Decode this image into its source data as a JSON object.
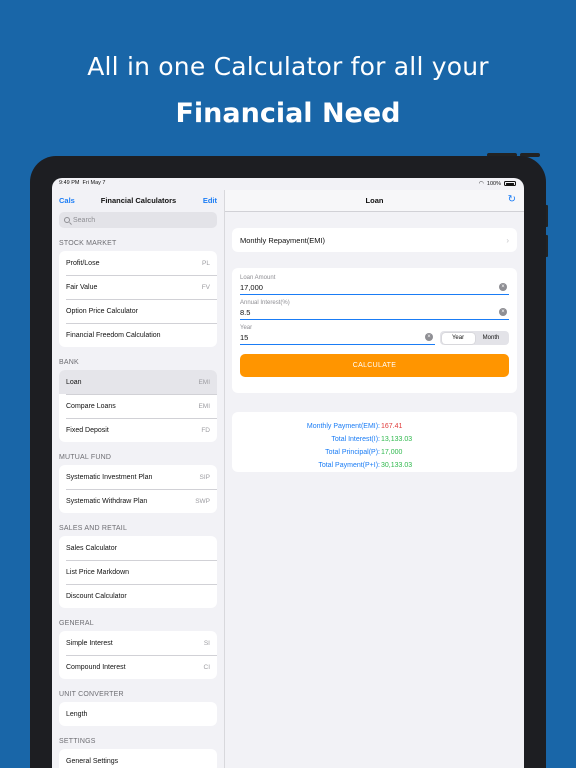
{
  "headline": {
    "line1": "All in one Calculator for all your",
    "line2": "Financial Need"
  },
  "status_bar": {
    "time": "9:49 PM",
    "date": "Fri May 7",
    "battery": "100%"
  },
  "sidebar": {
    "back_label": "Cals",
    "title": "Financial Calculators",
    "edit_label": "Edit",
    "search_placeholder": "Search",
    "sections": [
      {
        "header": "STOCK MARKET",
        "items": [
          {
            "label": "Profit/Lose",
            "abbr": "PL"
          },
          {
            "label": "Fair Value",
            "abbr": "FV"
          },
          {
            "label": "Option Price Calculator",
            "abbr": ""
          },
          {
            "label": "Financial Freedom Calculation",
            "abbr": ""
          }
        ]
      },
      {
        "header": "BANK",
        "items": [
          {
            "label": "Loan",
            "abbr": "EMI",
            "selected": true
          },
          {
            "label": "Compare Loans",
            "abbr": "EMI"
          },
          {
            "label": "Fixed Deposit",
            "abbr": "FD"
          }
        ]
      },
      {
        "header": "MUTUAL FUND",
        "items": [
          {
            "label": "Systematic Investment Plan",
            "abbr": "SIP"
          },
          {
            "label": "Systematic Withdraw Plan",
            "abbr": "SWP"
          }
        ]
      },
      {
        "header": "SALES AND RETAIL",
        "items": [
          {
            "label": "Sales Calculator",
            "abbr": ""
          },
          {
            "label": "List Price Markdown",
            "abbr": ""
          },
          {
            "label": "Discount Calculator",
            "abbr": ""
          }
        ]
      },
      {
        "header": "GENERAL",
        "items": [
          {
            "label": "Simple Interest",
            "abbr": "SI"
          },
          {
            "label": "Compound Interest",
            "abbr": "CI"
          }
        ]
      },
      {
        "header": "UNIT CONVERTER",
        "items": [
          {
            "label": "Length",
            "abbr": ""
          }
        ]
      },
      {
        "header": "SETTINGS",
        "items": [
          {
            "label": "General Settings",
            "abbr": ""
          }
        ]
      }
    ]
  },
  "detail": {
    "title": "Loan",
    "emi_selector": "Monthly Repayment(EMI)",
    "loan_amount": {
      "label": "Loan Amount",
      "value": "17,000"
    },
    "interest": {
      "label": "Annual Interest(%)",
      "value": "8.5"
    },
    "year": {
      "label": "Year",
      "value": "15"
    },
    "segment": {
      "options": [
        "Year",
        "Month"
      ],
      "selected": "Year"
    },
    "calculate_label": "CALCULATE",
    "results": [
      {
        "label": "Monthly Payment(EMI):",
        "value": "167.41",
        "color": "red"
      },
      {
        "label": "Total Interest(I):",
        "value": "13,133.03",
        "color": "green"
      },
      {
        "label": "Total Principal(P):",
        "value": "17,000",
        "color": "green"
      },
      {
        "label": "Total Payment(P+I):",
        "value": "30,133.03",
        "color": "green"
      }
    ]
  },
  "colors": {
    "background": "#1966a8",
    "accent": "#1a7cf5",
    "calculate_button": "#ff9500",
    "result_emi": "#e03b3b",
    "result_other": "#2fb84d"
  }
}
